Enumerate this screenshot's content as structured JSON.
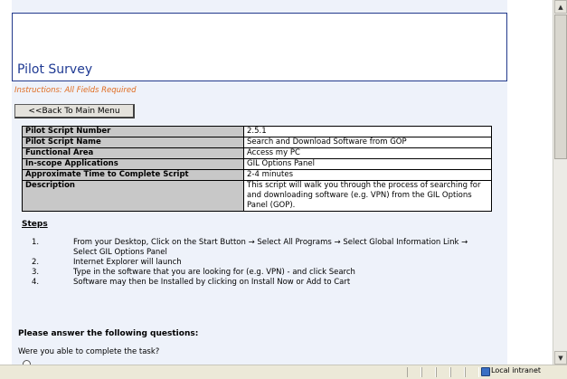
{
  "header": {
    "title": "Pilot Survey"
  },
  "instructions": "Instructions: All Fields Required",
  "back_button": "<<Back To Main Menu",
  "info_table": [
    {
      "label": "Pilot Script Number",
      "value": "2.5.1"
    },
    {
      "label": "Pilot Script Name",
      "value": "Search and Download Software from GOP"
    },
    {
      "label": "Functional Area",
      "value": "Access my PC"
    },
    {
      "label": "In-scope Applications",
      "value": "GIL Options Panel"
    },
    {
      "label": "Approximate Time to Complete Script",
      "value": "2-4 minutes"
    },
    {
      "label": "Description",
      "value": "This script will walk you through the process of searching for and downloading software (e.g. VPN) from the GIL Options Panel (GOP)."
    }
  ],
  "steps": {
    "title": "Steps",
    "items": [
      {
        "num": "1.",
        "text": "From your Desktop, Click on the Start Button → Select All Programs → Select Global Information Link → Select GIL Options Panel"
      },
      {
        "num": "2.",
        "text": "Internet Explorer will launch"
      },
      {
        "num": "3.",
        "text": "Type in the software that you are looking for (e.g. VPN) - and click Search"
      },
      {
        "num": "4.",
        "text": "Software may then be Installed by clicking on Install Now or Add to Cart"
      }
    ]
  },
  "questions": {
    "title": "Please answer the following questions:",
    "q1": "Were you able to complete the task?"
  },
  "statusbar": {
    "zone": "Local intranet"
  }
}
